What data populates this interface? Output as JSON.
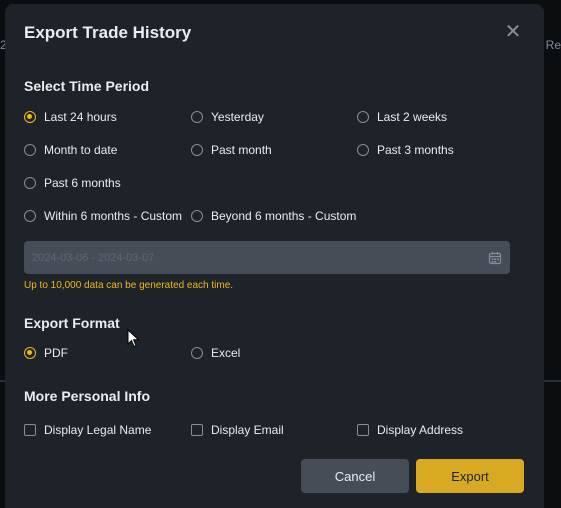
{
  "background": {
    "left_text": "2",
    "right_text": "Re"
  },
  "modal": {
    "title": "Export Trade History",
    "close_icon": "close-icon"
  },
  "time_period": {
    "heading": "Select Time Period",
    "options": [
      {
        "label": "Last 24 hours",
        "checked": true
      },
      {
        "label": "Yesterday",
        "checked": false
      },
      {
        "label": "Last 2 weeks",
        "checked": false
      },
      {
        "label": "Month to date",
        "checked": false
      },
      {
        "label": "Past month",
        "checked": false
      },
      {
        "label": "Past 3 months",
        "checked": false
      },
      {
        "label": "Past 6 months",
        "checked": false
      },
      {
        "label": "Within 6 months - Custom",
        "checked": false
      },
      {
        "label": "Beyond 6 months - Custom",
        "checked": false
      }
    ],
    "date_range_value": "2024-03-06 - 2024-03-07",
    "calendar_icon": "calendar-icon",
    "note": "Up to 10,000 data can be generated each time."
  },
  "export_format": {
    "heading": "Export Format",
    "options": [
      {
        "label": "PDF",
        "checked": true
      },
      {
        "label": "Excel",
        "checked": false
      }
    ]
  },
  "personal_info": {
    "heading": "More Personal Info",
    "options": [
      {
        "label": "Display Legal Name",
        "checked": false
      },
      {
        "label": "Display Email",
        "checked": false
      },
      {
        "label": "Display Address",
        "checked": false
      }
    ]
  },
  "buttons": {
    "cancel": "Cancel",
    "export": "Export"
  },
  "colors": {
    "accent": "#f0b90b",
    "modal_bg": "#1e2329",
    "input_bg": "#474d57"
  }
}
